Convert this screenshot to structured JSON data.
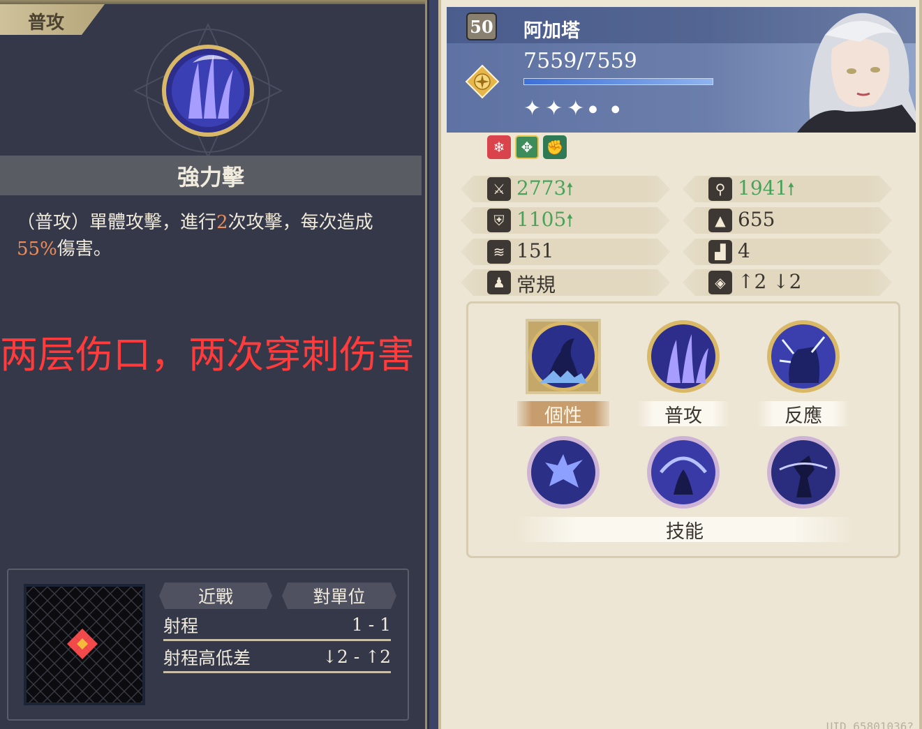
{
  "left": {
    "category_tag": "普攻",
    "skill_name": "強力擊",
    "description": {
      "part1": "（普攻）單體攻擊，進行",
      "hits": "2",
      "part2": "次攻擊，每次造成",
      "percent": "55%",
      "part3": "傷害。"
    },
    "annotation": "两层伤口，两次穿刺伤害",
    "range": {
      "tag_attack_type": "近戰",
      "tag_target": "對單位",
      "range_label": "射程",
      "range_value": "1 - 1",
      "height_label": "射程高低差",
      "height_value": "↓2 - ↑2"
    }
  },
  "character": {
    "level": "50",
    "name": "阿加塔",
    "hp": "7559/7559",
    "hp_fraction": 1.0,
    "stars_filled": 3,
    "stars_total": 5,
    "element_icon": "compass-star-icon",
    "traits": [
      {
        "icon": "snowflake-icon",
        "glyph": "❄"
      },
      {
        "icon": "paw-icon",
        "glyph": "✥"
      },
      {
        "icon": "fist-icon",
        "glyph": "✊"
      }
    ]
  },
  "stats": {
    "attack": {
      "icon": "sword-icon",
      "value": "2773",
      "arrow": "🠕"
    },
    "magic_attack": {
      "icon": "staff-icon",
      "value": "1941",
      "arrow": "🠕"
    },
    "defense": {
      "icon": "shield-icon",
      "value": "1105",
      "arrow": "🠕"
    },
    "magic_defense": {
      "icon": "hat-icon",
      "value": "655"
    },
    "speed": {
      "icon": "wing-icon",
      "value": "151"
    },
    "move": {
      "icon": "boot-icon",
      "value": "4"
    },
    "movement_type": {
      "icon": "figure-icon",
      "value": "常規"
    },
    "jump": {
      "icon": "jump-icon",
      "value": "↑2 ↓2"
    }
  },
  "skills": {
    "trait_label": "個性",
    "basic_label": "普攻",
    "reaction_label": "反應",
    "skills_label": "技能"
  },
  "footer": {
    "uid": "UID 65801036?"
  },
  "colors": {
    "accent_orange": "#e98d5d",
    "annotation_red": "#ff3b3b",
    "stat_up_green": "#4aa25a",
    "panel_dark": "#353849",
    "panel_light": "#ede6d5"
  }
}
